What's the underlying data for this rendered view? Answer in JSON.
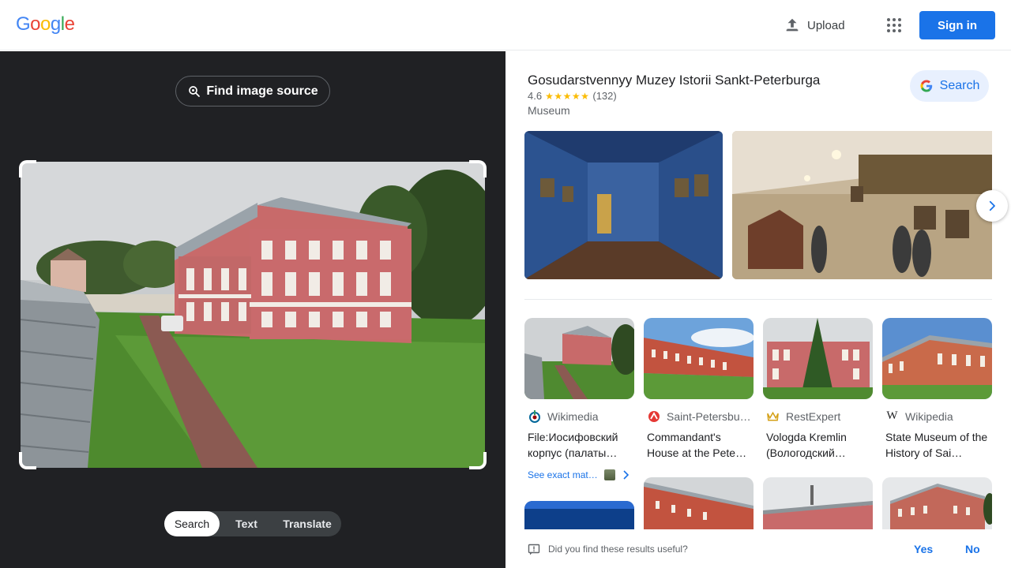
{
  "header": {
    "logo_letters": [
      "G",
      "o",
      "o",
      "g",
      "l",
      "e"
    ],
    "logo_colors": [
      "#4285f4",
      "#ea4335",
      "#fbbc05",
      "#4285f4",
      "#34a853",
      "#ea4335"
    ],
    "upload_label": "Upload",
    "upload_icon": "upload-icon",
    "apps_icon": "apps-grid-icon",
    "signin_label": "Sign in",
    "accent_color": "#1a73e8"
  },
  "lens": {
    "find_source_label": "Find image source",
    "find_source_icon": "lens-search-icon",
    "modes": [
      {
        "label": "Search",
        "active": true
      },
      {
        "label": "Text",
        "active": false
      },
      {
        "label": "Translate",
        "active": false
      }
    ]
  },
  "knowledge_panel": {
    "title": "Gosudarstvennyy Muzey Istorii Sankt-Peterburga",
    "rating": "4.6",
    "stars": "★★★★★",
    "review_count": "(132)",
    "type": "Museum",
    "search_label": "Search"
  },
  "results": [
    {
      "source": "Wikimedia",
      "title": "File:Иосифовский корпус (палаты…",
      "favicon": "wikimedia-icon"
    },
    {
      "source": "Saint-Petersbu…",
      "title": "Commandant's House at the Pete…",
      "favicon": "spb-icon"
    },
    {
      "source": "RestExpert",
      "title": "Vologda Kremlin (Вологодский…",
      "favicon": "restexpert-icon"
    },
    {
      "source": "Wikipedia",
      "title": "State Museum of the History of Sai…",
      "favicon": "wikipedia-icon"
    }
  ],
  "see_exact_label": "See exact mat…",
  "feedback": {
    "question": "Did you find these results useful?",
    "yes_label": "Yes",
    "no_label": "No"
  }
}
